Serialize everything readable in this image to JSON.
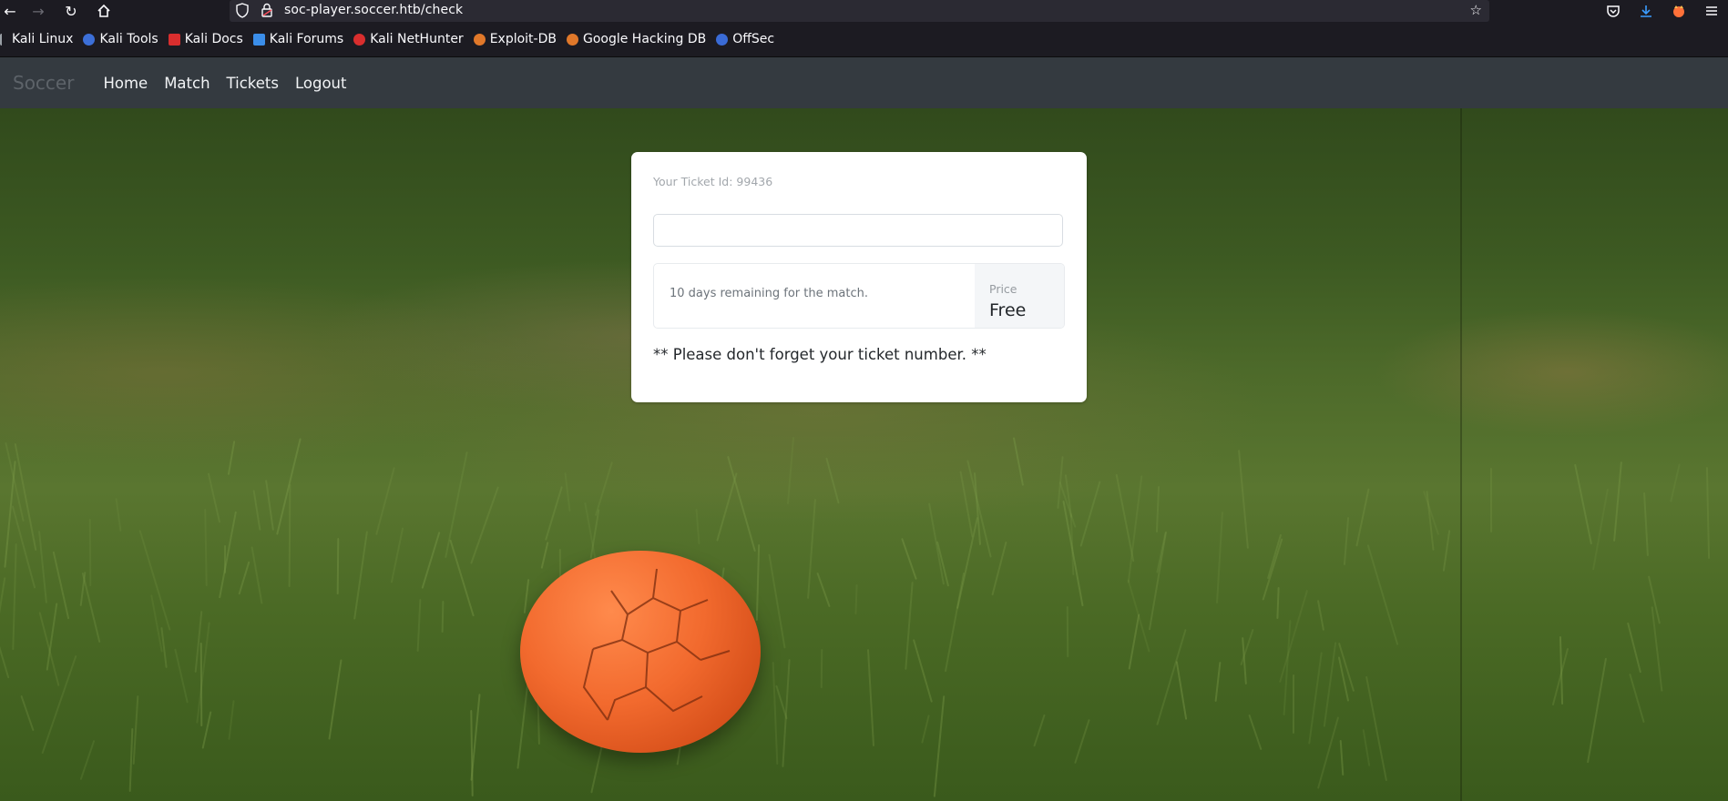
{
  "browser": {
    "url": "soc-player.soccer.htb/check",
    "bookmarks": [
      {
        "label": "Kali Linux",
        "icon": "kali-linux-icon",
        "color": "#3b8eea"
      },
      {
        "label": "Kali Tools",
        "icon": "kali-tools-icon",
        "color": "#3c6fd8"
      },
      {
        "label": "Kali Docs",
        "icon": "kali-docs-icon",
        "color": "#d92e2e"
      },
      {
        "label": "Kali Forums",
        "icon": "kali-forums-icon",
        "color": "#3b8eea"
      },
      {
        "label": "Kali NetHunter",
        "icon": "kali-nethunter-icon",
        "color": "#d92e2e"
      },
      {
        "label": "Exploit-DB",
        "icon": "exploit-db-icon",
        "color": "#e0782a"
      },
      {
        "label": "Google Hacking DB",
        "icon": "google-hacking-db-icon",
        "color": "#e0782a"
      },
      {
        "label": "OffSec",
        "icon": "offsec-icon",
        "color": "#3a6bd6"
      }
    ]
  },
  "site": {
    "brand": "Soccer",
    "nav": [
      {
        "label": "Home",
        "name": "nav-home"
      },
      {
        "label": "Match",
        "name": "nav-match"
      },
      {
        "label": "Tickets",
        "name": "nav-tickets"
      },
      {
        "label": "Logout",
        "name": "nav-logout"
      }
    ]
  },
  "ticket": {
    "id_text": "Your Ticket Id: 99436",
    "input_value": "",
    "remaining_text": "10 days remaining for the match.",
    "price_label": "Price",
    "price_value": "Free",
    "reminder": "** Please don't forget your ticket number. **"
  },
  "colors": {
    "navbar_bg": "#343a40",
    "browser_chrome": "#1c1b22",
    "ball_orange": "#f26a2e"
  }
}
